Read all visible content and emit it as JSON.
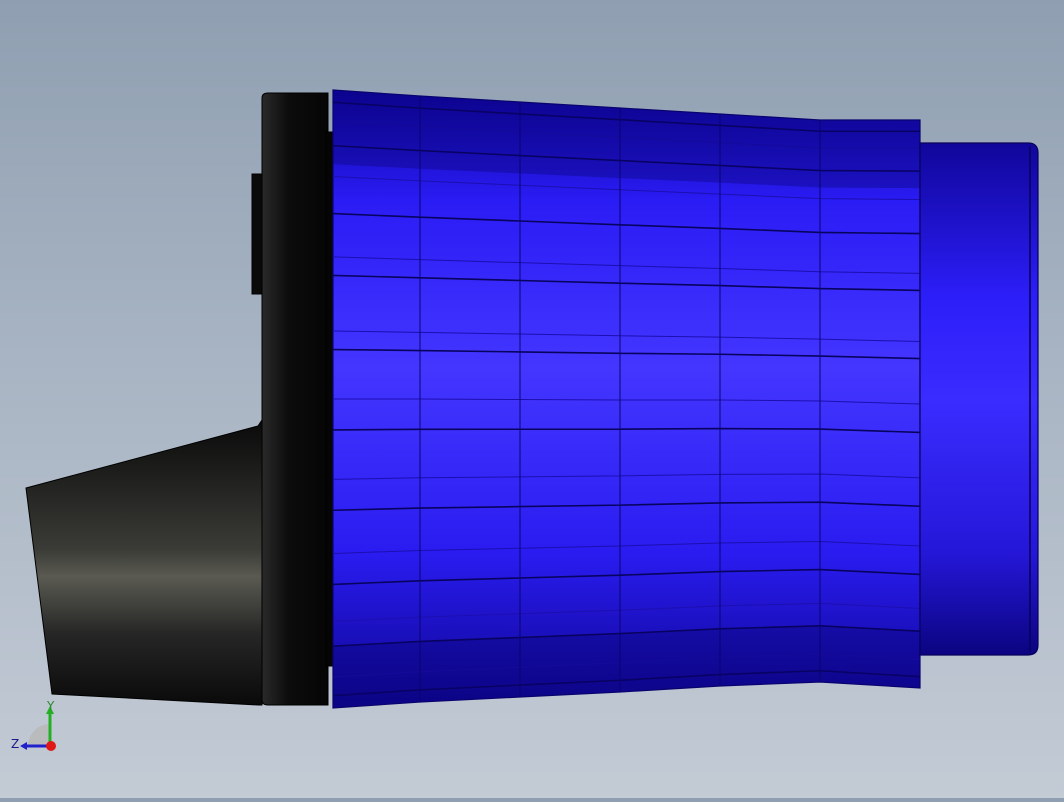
{
  "viewport": {
    "background_top": "#8f9fb1",
    "background_bottom": "#c3cbd5"
  },
  "model": {
    "body_color": "#2d1fff",
    "body_dark": "#1408b8",
    "cap_color": "#0b0b0b",
    "nozzle_color": "#1a1a1a"
  },
  "triad": {
    "y_label": "Y",
    "z_label": "Z",
    "y_color": "#22b022",
    "z_color": "#2222cc",
    "origin_color": "#e01818"
  }
}
